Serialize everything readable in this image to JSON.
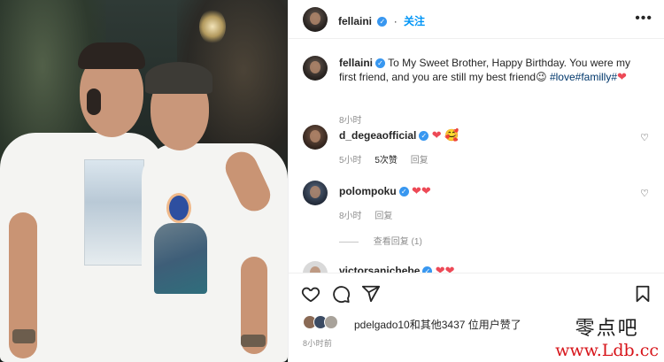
{
  "post": {
    "username": "fellaini",
    "follow_label": "关注",
    "more_label": "•••"
  },
  "caption": {
    "username": "fellaini",
    "text": "To My Sweet Brother, Happy Birthday. You were my first friend, and you are still my best friend",
    "emoji_smile": "😉",
    "hashtags": "#love#familly#",
    "emoji_heart": "❤",
    "time": "8小时"
  },
  "comments": [
    {
      "username": "d_degeaofficial",
      "text": "❤ 🥰",
      "time": "5小时",
      "likes": "5次赞",
      "reply": "回复"
    },
    {
      "username": "polompoku",
      "text": "❤❤",
      "time": "8小时",
      "reply": "回复"
    },
    {
      "username": "victorsanichebe",
      "text": "❤❤"
    }
  ],
  "view_replies": "查看回复 (1)",
  "likes": {
    "text": "pdelgado10和其他3437 位用户赞了"
  },
  "timestamp": "8小时前",
  "watermark": {
    "cn": "零点吧",
    "url": "www.Ldb.cc"
  },
  "colors": {
    "accent": "#0095f6",
    "verified": "#3897f0",
    "heart": "#ed4956"
  }
}
